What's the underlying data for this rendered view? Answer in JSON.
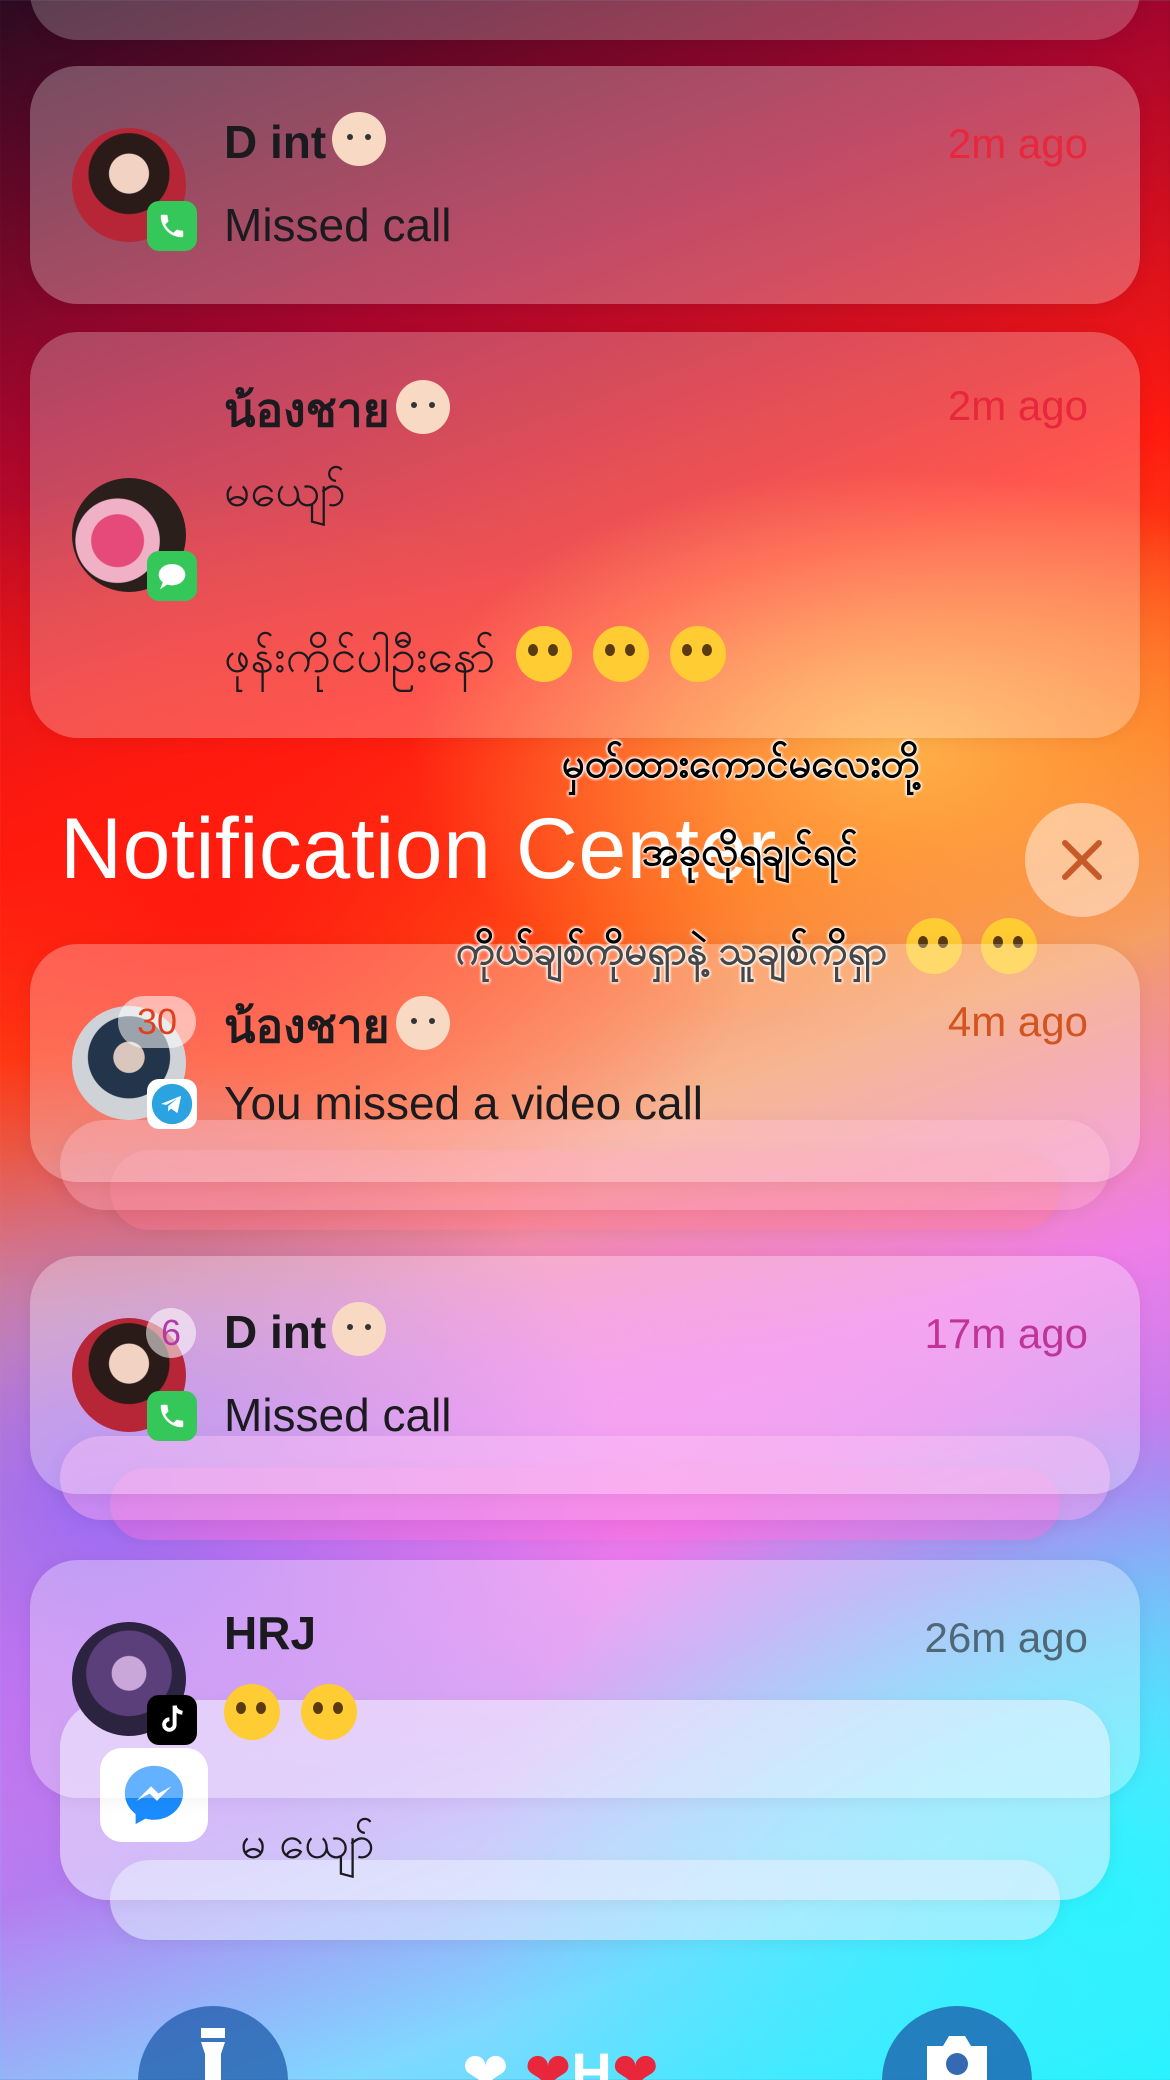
{
  "notifications_top": [
    {
      "name": "D int",
      "time": "2m ago",
      "message": "Missed call",
      "app": "phone",
      "avatar": "girl-with-glasses"
    },
    {
      "name": "น้องชาย",
      "time": "2m ago",
      "message_line1": "မယျော်",
      "message_line2": "ဖုန်းကိုင်ပါဦးနော်",
      "app": "messages",
      "avatar": "girl-with-pink-toy"
    }
  ],
  "notification_center": {
    "title": "Notification Center",
    "close_icon": "close-icon"
  },
  "overlay_text": {
    "line1": "မှတ်ထားကောင်မလေးတို့",
    "line2": "အခုလိုရချင်ရင်",
    "line3": "ကိုယ်ချစ်ကိုမရှာနဲ့ သူချစ်ကိုရှာ"
  },
  "notifications_bottom": [
    {
      "name": "น้องชาย",
      "time": "4m ago",
      "message": "You missed a video call",
      "app": "telegram",
      "count": "30"
    },
    {
      "name": "D int",
      "time": "17m ago",
      "message": "Missed call",
      "app": "phone",
      "count": "6"
    },
    {
      "name": "HRJ",
      "time": "26m ago",
      "message": "",
      "app": "tiktok"
    },
    {
      "message": "မ ယျော်",
      "app": "messenger"
    }
  ],
  "bottom_bar": {
    "left_icon": "flashlight-icon",
    "right_icon": "camera-icon",
    "center_text": "H"
  },
  "colors": {
    "time_red": "#e8263c",
    "time_orange": "#d2541e",
    "time_pink": "#c0349a",
    "time_slate": "#4f6878",
    "phone_green": "#35c759",
    "telegram_blue": "#2aa3e0"
  }
}
